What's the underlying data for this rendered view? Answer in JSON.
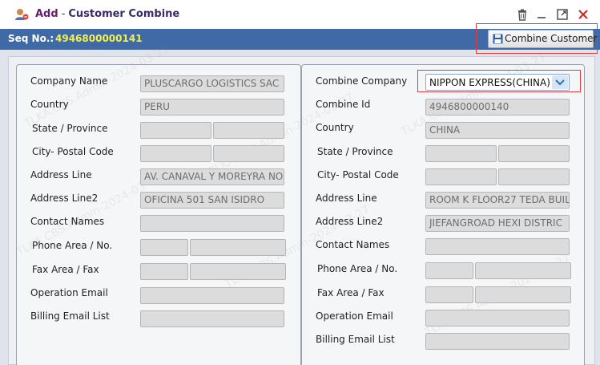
{
  "window": {
    "title_add": "Add",
    "title_sep": "-",
    "title_main": "Customer Combine"
  },
  "seq": {
    "label": "Seq No.:",
    "value": "4946800000141"
  },
  "combine_button": {
    "label": "Combine Customer"
  },
  "left": {
    "company_name": {
      "label": "Company Name",
      "value": "PLUSCARGO LOGISTICS SAC"
    },
    "country": {
      "label": "Country",
      "value": "PERU"
    },
    "state_province": {
      "label": "State / Province",
      "value_a": "",
      "value_b": ""
    },
    "city_postal": {
      "label": "City- Postal Code",
      "value_a": "",
      "value_b": ""
    },
    "address_line": {
      "label": "Address Line",
      "value": "AV. CANAVAL Y MOREYRA NO"
    },
    "address_line2": {
      "label": "Address Line2",
      "value": "OFICINA 501 SAN ISIDRO"
    },
    "contact_names": {
      "label": "Contact Names",
      "value": ""
    },
    "phone": {
      "label": "Phone Area /  No.",
      "value_a": "",
      "value_b": ""
    },
    "fax": {
      "label": "Fax Area /  Fax",
      "value_a": "",
      "value_b": ""
    },
    "operation_email": {
      "label": "Operation Email",
      "value": ""
    },
    "billing_email": {
      "label": "Billing Email List",
      "value": ""
    }
  },
  "right": {
    "combine_company": {
      "label": "Combine Company",
      "value": "NIPPON EXPRESS(CHINA)"
    },
    "combine_id": {
      "label": "Combine Id",
      "value": "4946800000140"
    },
    "country": {
      "label": "Country",
      "value": "CHINA"
    },
    "state_province": {
      "label": "State / Province",
      "value_a": "",
      "value_b": ""
    },
    "city_postal": {
      "label": "City- Postal Code",
      "value_a": "",
      "value_b": ""
    },
    "address_line": {
      "label": "Address Line",
      "value": "ROOM K FLOOR27 TEDA BUIL"
    },
    "address_line2": {
      "label": "Address Line2",
      "value": "JIEFANGROAD HEXI DISTRIC"
    },
    "contact_names": {
      "label": "Contact Names",
      "value": ""
    },
    "phone": {
      "label": "Phone Area /  No.",
      "value_a": "",
      "value_b": ""
    },
    "fax": {
      "label": "Fax Area /  Fax",
      "value_a": "",
      "value_b": ""
    },
    "operation_email": {
      "label": "Operation Email",
      "value": ""
    },
    "billing_email": {
      "label": "Billing Email List",
      "value": ""
    }
  },
  "watermark": {
    "text": "TLKA.CBS.Admin-2024-03-27"
  },
  "colors": {
    "seq_bar": "#3f6aa6",
    "seq_value": "#f2f04a",
    "highlight": "#e03a3a",
    "field_bg": "#dcdcdc"
  },
  "icons": {
    "app": "user-add-icon",
    "trash": "trash-icon",
    "minimize": "minimize-icon",
    "maximize": "maximize-icon",
    "close": "close-icon",
    "save": "save-icon",
    "dropdown": "chevron-down-icon"
  }
}
